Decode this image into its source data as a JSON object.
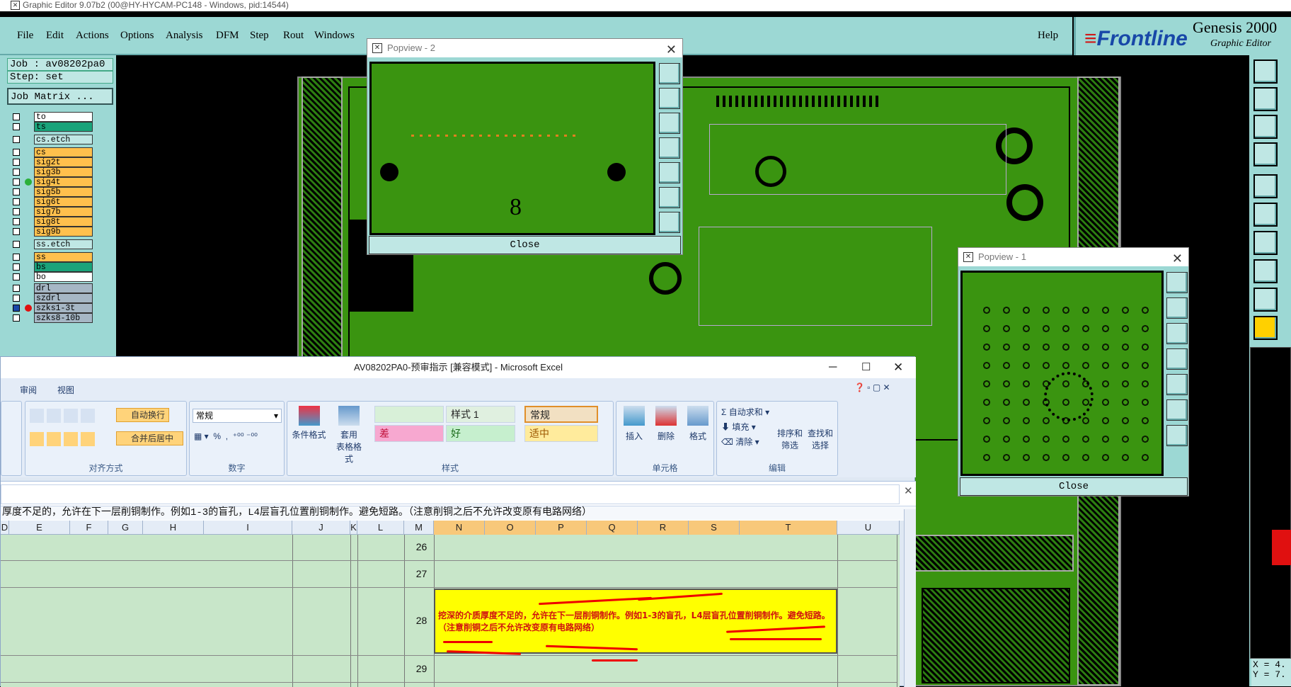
{
  "genesis": {
    "window_title": "Graphic Editor 9.07b2 (00@HY-HYCAM-PC148 - Windows, pid:14544)",
    "menu": [
      "File",
      "Edit",
      "Actions",
      "Options",
      "Analysis",
      "DFM",
      "Step",
      "Rout",
      "Windows"
    ],
    "help": "Help",
    "brand": "Frontline",
    "product": "Genesis 2000",
    "subtitle": "Graphic Editor",
    "job_label": "Job : av08202pa0",
    "step_label": "Step: set",
    "job_matrix_button": "Job Matrix ...",
    "layers": [
      {
        "name": "to",
        "color": "#ffffff"
      },
      {
        "name": "ts",
        "color": "#1aa37a"
      },
      {
        "name": "cs.etch",
        "color": "#bfe7e4"
      },
      {
        "name": "cs",
        "color": "#ffc04d"
      },
      {
        "name": "sig2t",
        "color": "#ffc04d"
      },
      {
        "name": "sig3b",
        "color": "#ffc04d"
      },
      {
        "name": "sig4t",
        "color": "#ffc04d"
      },
      {
        "name": "sig5b",
        "color": "#ffc04d"
      },
      {
        "name": "sig6t",
        "color": "#ffc04d"
      },
      {
        "name": "sig7b",
        "color": "#ffc04d"
      },
      {
        "name": "sig8t",
        "color": "#ffc04d"
      },
      {
        "name": "sig9b",
        "color": "#ffc04d"
      },
      {
        "name": "ss.etch",
        "color": "#bfe7e4"
      },
      {
        "name": "ss",
        "color": "#ffc04d"
      },
      {
        "name": "bs",
        "color": "#1aa37a"
      },
      {
        "name": "bo",
        "color": "#ffffff"
      },
      {
        "name": "drl",
        "color": "#a6b7c5"
      },
      {
        "name": "szdrl",
        "color": "#a6b7c5"
      },
      {
        "name": "szks1-3t",
        "color": "#a6b7c5"
      },
      {
        "name": "szks8-10b",
        "color": "#a6b7c5"
      }
    ],
    "coords": [
      "X = 4.",
      "Y = 7."
    ]
  },
  "popview2": {
    "title": "Popview - 2",
    "close": "Close",
    "label": "8"
  },
  "popview1": {
    "title": "Popview - 1",
    "close": "Close"
  },
  "excel": {
    "title": "AV08202PA0-预审指示  [兼容模式] - Microsoft Excel",
    "tabs": [
      "审阅",
      "视图"
    ],
    "wrap_text": "自动换行",
    "merge_center": "合并后居中",
    "number_format": "常规",
    "groups": {
      "alignment": "对齐方式",
      "number": "数字",
      "styles": "样式",
      "cells": "单元格",
      "editing": "编辑"
    },
    "cond_format": "条件格式",
    "table_format": [
      "套用",
      "表格格式"
    ],
    "style_cells": {
      "s1": "样式 1",
      "normal": "常规",
      "bad": "差",
      "good": "好",
      "neutral": "适中"
    },
    "cell_buttons": [
      "插入",
      "删除",
      "格式"
    ],
    "edit_buttons": {
      "autosum": "自动求和",
      "fill": "填充",
      "clear": "清除",
      "sort": [
        "排序和",
        "筛选"
      ],
      "find": [
        "查找和",
        "选择"
      ]
    },
    "formula_text": "厚度不足的，允许在下一层削铜制作。例如1-3的盲孔，L4层盲孔位置削铜制作。避免短路。（注意削铜之后不允许改变原有电路网络）",
    "columns": [
      "D",
      "E",
      "F",
      "G",
      "H",
      "I",
      "J",
      "K",
      "L",
      "M",
      "N",
      "O",
      "P",
      "Q",
      "R",
      "S",
      "T",
      "U"
    ],
    "rows": [
      "26",
      "27",
      "28",
      "29"
    ],
    "note_text": "挖深的介质厚度不足的，允许在下一层削铜制作。例如1-3的盲孔，L4层盲孔位置削铜制作。避免短路。（注意削铜之后不允许改变原有电路网络）"
  }
}
